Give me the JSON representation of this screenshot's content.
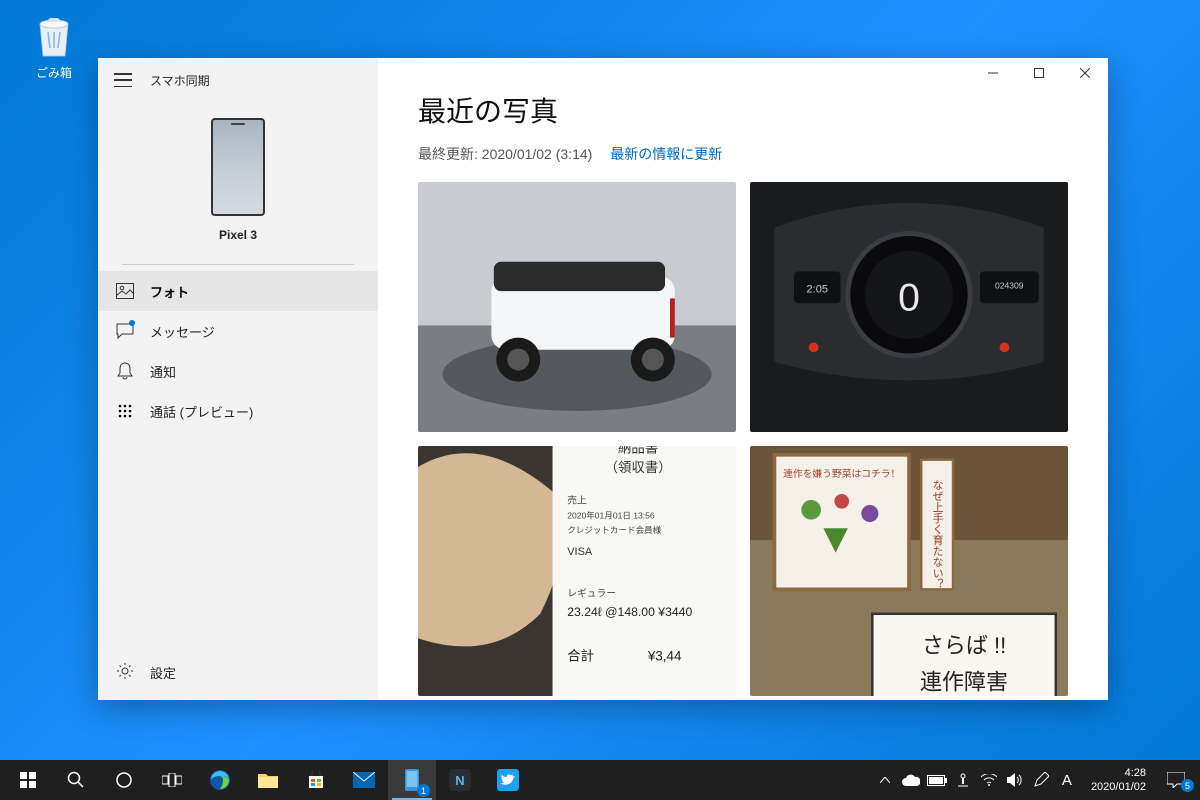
{
  "desktop": {
    "recycle_bin": "ごみ箱"
  },
  "window": {
    "app_title": "スマホ同期",
    "device_name": "Pixel 3",
    "nav": {
      "photos": "フォト",
      "messages": "メッセージ",
      "notifications": "通知",
      "calls": "通話 (プレビュー)",
      "settings": "設定"
    }
  },
  "main": {
    "heading": "最近の写真",
    "last_updated": "最終更新: 2020/01/02 (3:14)",
    "refresh_link": "最新の情報に更新",
    "photos": [
      {
        "alt": "白い小型オープンカー（ターンテーブル上）"
      },
      {
        "alt": "車のデジタルメーター（2:05、0 km/h、10°C、024309 km）"
      },
      {
        "alt": "ガソリンスタンドの領収書（レギュラー 23.24L @148.00 ¥3440、VISA、2020年01月01日 13:56）"
      },
      {
        "alt": "直売所の看板（さらば!! 連作障害、なぜ上手く育たない？、連作を嫌う野菜はコチラ！）"
      }
    ]
  },
  "taskbar": {
    "badge_phone": "1",
    "tray": {
      "ime": "A",
      "notif_count": "5"
    },
    "clock": {
      "time": "4:28",
      "date": "2020/01/02"
    }
  }
}
